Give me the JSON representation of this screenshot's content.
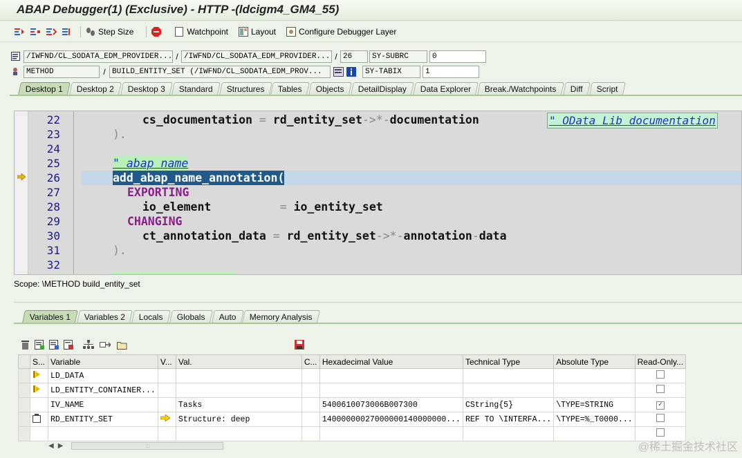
{
  "window": {
    "title": "ABAP Debugger(1)  (Exclusive) - HTTP -(ldcigm4_GM4_55)"
  },
  "toolbar": {
    "step_icons": [
      "step-into-icon",
      "step-over-icon",
      "return-icon",
      "continue-icon"
    ],
    "step_size_label": "Step Size",
    "watchpoint_label": "Watchpoint",
    "layout_label": "Layout",
    "configure_label": "Configure Debugger Layer"
  },
  "info": {
    "program": "/IWFND/CL_SODATA_EDM_PROVIDER...",
    "include": "/IWFND/CL_SODATA_EDM_PROVIDER...",
    "line": "26",
    "sy_subrc_label": "SY-SUBRC",
    "sy_subrc_value": "0",
    "event_type": "METHOD",
    "event": "BUILD_ENTITY_SET (/IWFND/CL_SODATA_EDM_PROV...",
    "sy_tabix_label": "SY-TABIX",
    "sy_tabix_value": "1"
  },
  "main_tabs": [
    "Desktop 1",
    "Desktop 2",
    "Desktop 3",
    "Standard",
    "Structures",
    "Tables",
    "Objects",
    "DetailDisplay",
    "Data Explorer",
    "Break./Watchpoints",
    "Diff",
    "Script"
  ],
  "code": {
    "lines": [
      {
        "n": "22"
      },
      {
        "n": "23"
      },
      {
        "n": "24"
      },
      {
        "n": "25"
      },
      {
        "n": "26"
      },
      {
        "n": "27"
      },
      {
        "n": "28"
      },
      {
        "n": "29"
      },
      {
        "n": "30"
      },
      {
        "n": "31"
      },
      {
        "n": "32"
      }
    ],
    "l22_a": "cs_documentation",
    "l22_b": "rd_entity_set",
    "l22_c": "documentation",
    "l22_comment": "\" OData Lib documentation",
    "l23": ").",
    "l25_comment": "\" abap name",
    "l26": "add_abap_name_annotation(",
    "l27": "EXPORTING",
    "l28_a": "io_element",
    "l28_b": "io_entity_set",
    "l29": "CHANGING",
    "l30_a": "ct_annotation_data",
    "l30_b": "rd_entity_set",
    "l30_c": "annotation",
    "l30_d": "data",
    "l31": ").",
    "l33_partial": "\" ... ... ... ...."
  },
  "scope": "Scope: \\METHOD build_entity_set",
  "var_tabs": [
    "Variables 1",
    "Variables 2",
    "Locals",
    "Globals",
    "Auto",
    "Memory Analysis"
  ],
  "var_toolbar_icons": [
    "delete-icon",
    "export-icon",
    "import-icon",
    "save-list-icon",
    "structure-icon",
    "navigate-icon",
    "folder-icon",
    "save-icon"
  ],
  "table": {
    "headers": [
      "S...",
      "Variable",
      "V...",
      "Val.",
      "C...",
      "Hexadecimal Value",
      "Technical Type",
      "Absolute Type",
      "Read-Only..."
    ],
    "rows": [
      {
        "icon": "var-icon",
        "variable": "LD_DATA",
        "v": "",
        "val": "",
        "c": "",
        "hex": "",
        "tech": "",
        "abs": "",
        "ro": false
      },
      {
        "icon": "var-icon",
        "variable": "LD_ENTITY_CONTAINER...",
        "v": "",
        "val": "",
        "c": "",
        "hex": "",
        "tech": "",
        "abs": "",
        "ro": false
      },
      {
        "icon": "",
        "variable": "IV_NAME",
        "v": "",
        "val": "Tasks",
        "c": "",
        "hex": "5400610073006B007300",
        "tech": "CString{5}",
        "abs": "\\TYPE=STRING",
        "ro": true
      },
      {
        "icon": "ref-icon",
        "variable": "RD_ENTITY_SET",
        "v": "arrow",
        "val": "Structure: deep",
        "c": "",
        "hex": "14000000027000000140000000...",
        "tech": "REF TO \\INTERFA...",
        "abs": "\\TYPE=%_T0000...",
        "ro": false
      },
      {
        "icon": "",
        "variable": "",
        "v": "",
        "val": "",
        "c": "",
        "hex": "",
        "tech": "",
        "abs": "",
        "ro": false
      }
    ]
  },
  "scroll_thumb": ":::",
  "watermark": "@稀土掘金技术社区"
}
